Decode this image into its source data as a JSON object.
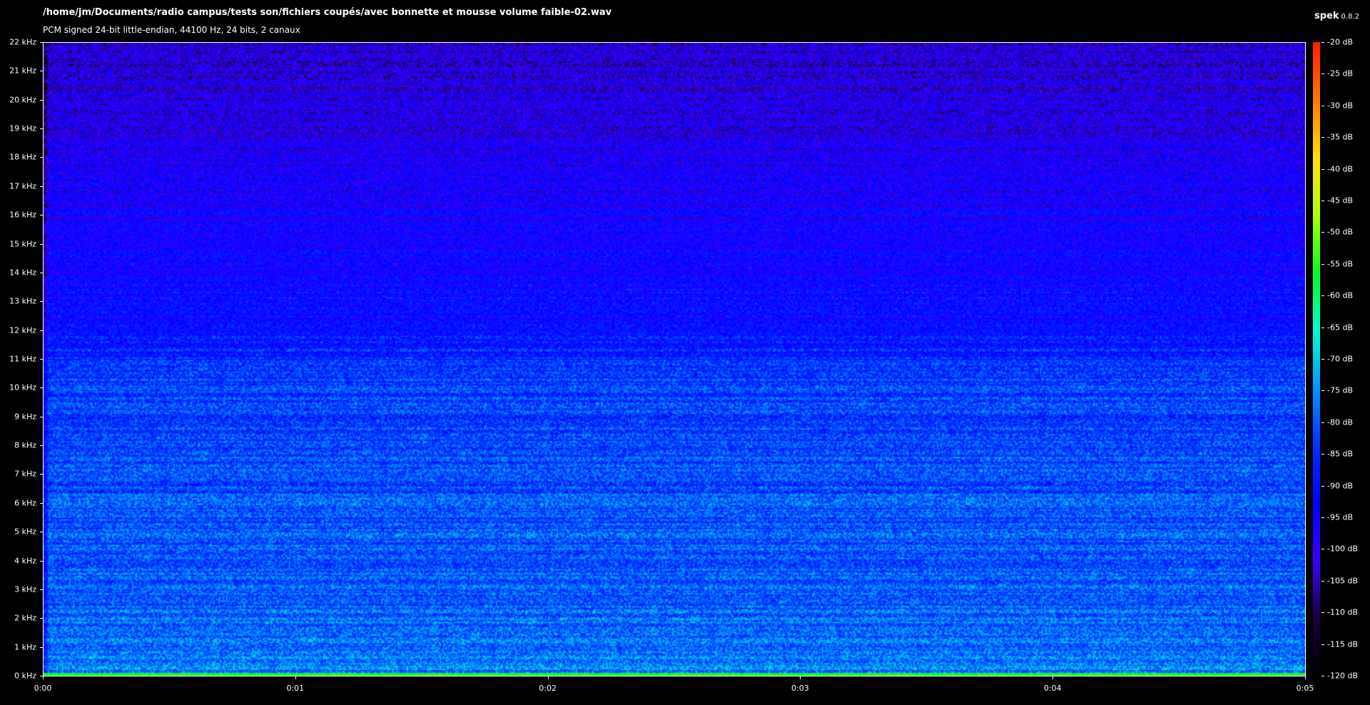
{
  "header": {
    "file_path": "/home/jm/Documents/radio campus/tests son/fichiers coupés/avec bonnette et mousse volume faible-02.wav",
    "file_info": "PCM signed 24-bit little-endian, 44100 Hz, 24 bits, 2 canaux",
    "app_name": "spek",
    "app_version": "0.8.2"
  },
  "freq_axis": {
    "labels": [
      "22 kHz",
      "21 kHz",
      "20 kHz",
      "19 kHz",
      "18 kHz",
      "17 kHz",
      "16 kHz",
      "15 kHz",
      "14 kHz",
      "13 kHz",
      "12 kHz",
      "11 kHz",
      "10 kHz",
      "9 kHz",
      "8 kHz",
      "7 kHz",
      "6 kHz",
      "5 kHz",
      "4 kHz",
      "3 kHz",
      "2 kHz",
      "1 kHz",
      "0 kHz"
    ]
  },
  "time_axis": {
    "labels": [
      "0:00",
      "0:01",
      "0:02",
      "0:03",
      "0:04",
      "0:05"
    ]
  },
  "db_scale": {
    "labels": [
      "-20 dB",
      "-25 dB",
      "-30 dB",
      "-35 dB",
      "-40 dB",
      "-45 dB",
      "-50 dB",
      "-55 dB",
      "-60 dB",
      "-65 dB",
      "-70 dB",
      "-75 dB",
      "-80 dB",
      "-85 dB",
      "-90 dB",
      "-95 dB",
      "-100 dB",
      "-105 dB",
      "-110 dB",
      "-115 dB",
      "-120 dB"
    ]
  },
  "colors": {
    "background": "#000000",
    "text": "#ffffff",
    "gradient": [
      "#ff1a00",
      "#ff7a00",
      "#ffe100",
      "#b4ff00",
      "#00ff20",
      "#00ffd2",
      "#0096ff",
      "#0032ff",
      "#0000ff",
      "#3a00ff",
      "#1a0040",
      "#000000"
    ]
  }
}
